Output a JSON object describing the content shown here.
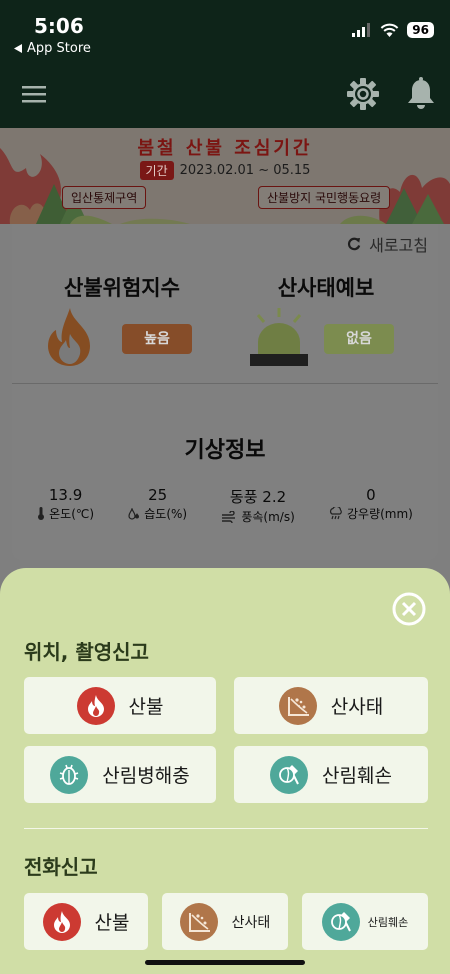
{
  "status_bar": {
    "time": "5:06",
    "back_label": "App Store",
    "battery": "96"
  },
  "banner": {
    "title": "봄철 산불 조심기간",
    "period_label": "기간",
    "period_dates": "2023.02.01 ~ 05.15",
    "left_button": "입산통제구역",
    "right_button": "산불방지 국민행동요령"
  },
  "info": {
    "refresh_label": "새로고침",
    "fire_risk": {
      "title": "산불위험지수",
      "level": "높음"
    },
    "landslide": {
      "title": "산사태예보",
      "level": "없음"
    },
    "weather": {
      "title": "기상정보",
      "items": [
        {
          "value": "13.9",
          "label": "온도(℃)",
          "icon": "thermometer-icon"
        },
        {
          "value": "25",
          "label": "습도(%)",
          "icon": "humidity-icon"
        },
        {
          "value": "동풍 2.2",
          "label": "풍속(m/s)",
          "icon": "wind-icon"
        },
        {
          "value": "0",
          "label": "강우량(mm)",
          "icon": "rain-icon"
        }
      ]
    }
  },
  "sheet": {
    "location_title": "위치, 촬영신고",
    "location_buttons": [
      "산불",
      "산사태",
      "산림병해충",
      "산림훼손"
    ],
    "phone_title": "전화신고",
    "phone_buttons": [
      "산불",
      "산사태",
      "산림훼손"
    ]
  },
  "colors": {
    "header_bg": "#0e2419",
    "sheet_bg": "#d0dea6",
    "fire_red": "#cc3a32",
    "landslide_brown": "#b0764a",
    "pest_teal": "#4fa89a",
    "high_badge": "#864d29",
    "none_badge": "#7c8c4f"
  }
}
